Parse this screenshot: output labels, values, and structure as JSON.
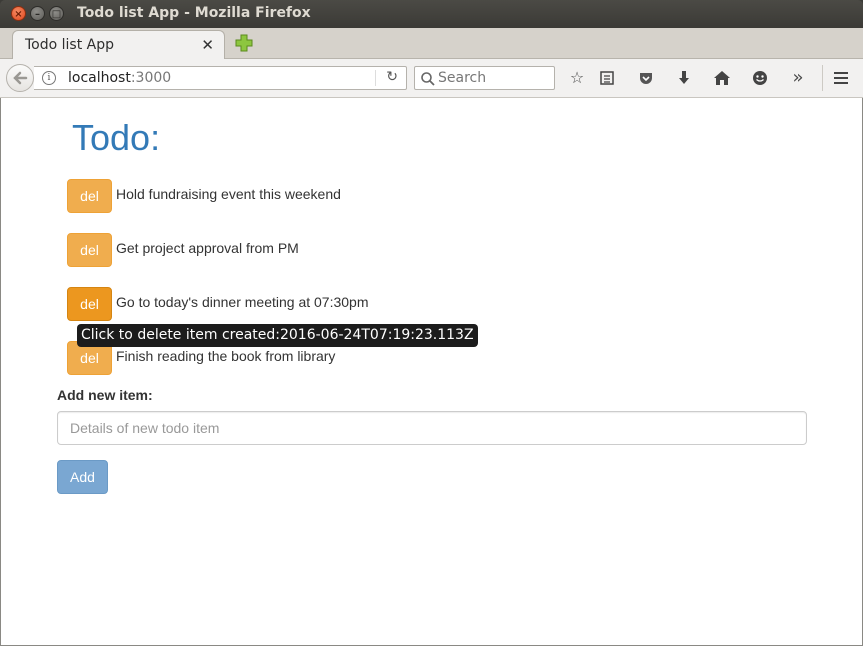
{
  "window": {
    "title": "Todo list App - Mozilla Firefox"
  },
  "tab": {
    "label": "Todo list App"
  },
  "navbar": {
    "url_host": "localhost",
    "url_port": ":3000",
    "search_placeholder": "Search"
  },
  "page": {
    "title": "Todo:",
    "del_label": "del",
    "todos": [
      {
        "text": "Hold fundraising event this weekend"
      },
      {
        "text": "Get project approval from PM"
      },
      {
        "text": "Go to today's dinner meeting at 07:30pm"
      },
      {
        "text": "Finish reading the book from library"
      }
    ],
    "tooltip": "Click to delete item created:2016-06-24T07:19:23.113Z",
    "add_label": "Add new item:",
    "add_placeholder": "Details of new todo item",
    "add_button": "Add"
  }
}
